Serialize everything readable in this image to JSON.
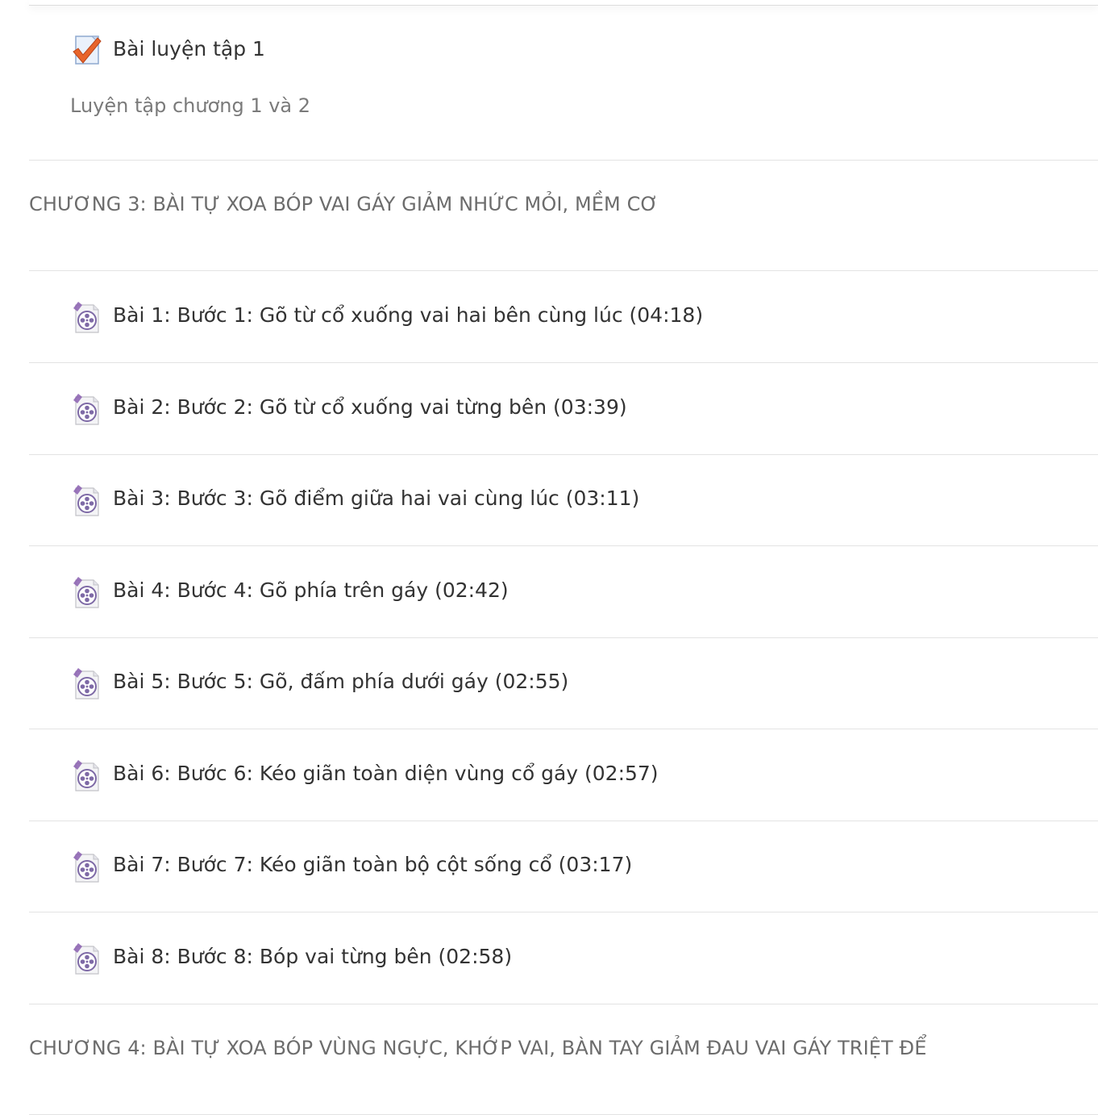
{
  "quiz": {
    "title": "Bài luyện tập 1",
    "description": "Luyện tập chương 1 và 2",
    "icon": "quiz-checkmark-icon"
  },
  "chapters": [
    {
      "title": "CHƯƠNG 3: BÀI TỰ XOA BÓP VAI GÁY GIẢM NHỨC MỎI, MỀM CƠ",
      "lessons": [
        {
          "label": "Bài 1: Bước 1: Gõ từ cổ xuống vai hai bên cùng lúc (04:18)",
          "icon": "video-film-reel-icon"
        },
        {
          "label": "Bài 2: Bước 2: Gõ từ cổ xuống vai từng bên (03:39)",
          "icon": "video-film-reel-icon"
        },
        {
          "label": "Bài 3: Bước 3: Gõ điểm giữa hai vai cùng lúc (03:11)",
          "icon": "video-film-reel-icon"
        },
        {
          "label": "Bài 4: Bước 4: Gõ phía trên gáy (02:42)",
          "icon": "video-film-reel-icon"
        },
        {
          "label": "Bài 5: Bước 5: Gõ, đấm phía dưới gáy (02:55)",
          "icon": "video-film-reel-icon"
        },
        {
          "label": "Bài 6: Bước 6: Kéo giãn toàn diện vùng cổ gáy (02:57)",
          "icon": "video-film-reel-icon"
        },
        {
          "label": "Bài 7: Bước 7: Kéo giãn toàn bộ cột sống cổ (03:17)",
          "icon": "video-film-reel-icon"
        },
        {
          "label": "Bài 8: Bước 8: Bóp vai từng bên (02:58)",
          "icon": "video-film-reel-icon"
        }
      ]
    },
    {
      "title": "CHƯƠNG 4: BÀI TỰ XOA BÓP VÙNG NGỰC, KHỚP VAI, BÀN TAY GIẢM ĐAU VAI GÁY TRIỆT ĐỂ",
      "lessons": []
    }
  ],
  "colors": {
    "text": "#333333",
    "muted": "#7a7a7a",
    "chapter": "#6c6c6c",
    "divider": "#e3e3e3",
    "check": "#e8642a",
    "video": "#8a5fb0"
  }
}
